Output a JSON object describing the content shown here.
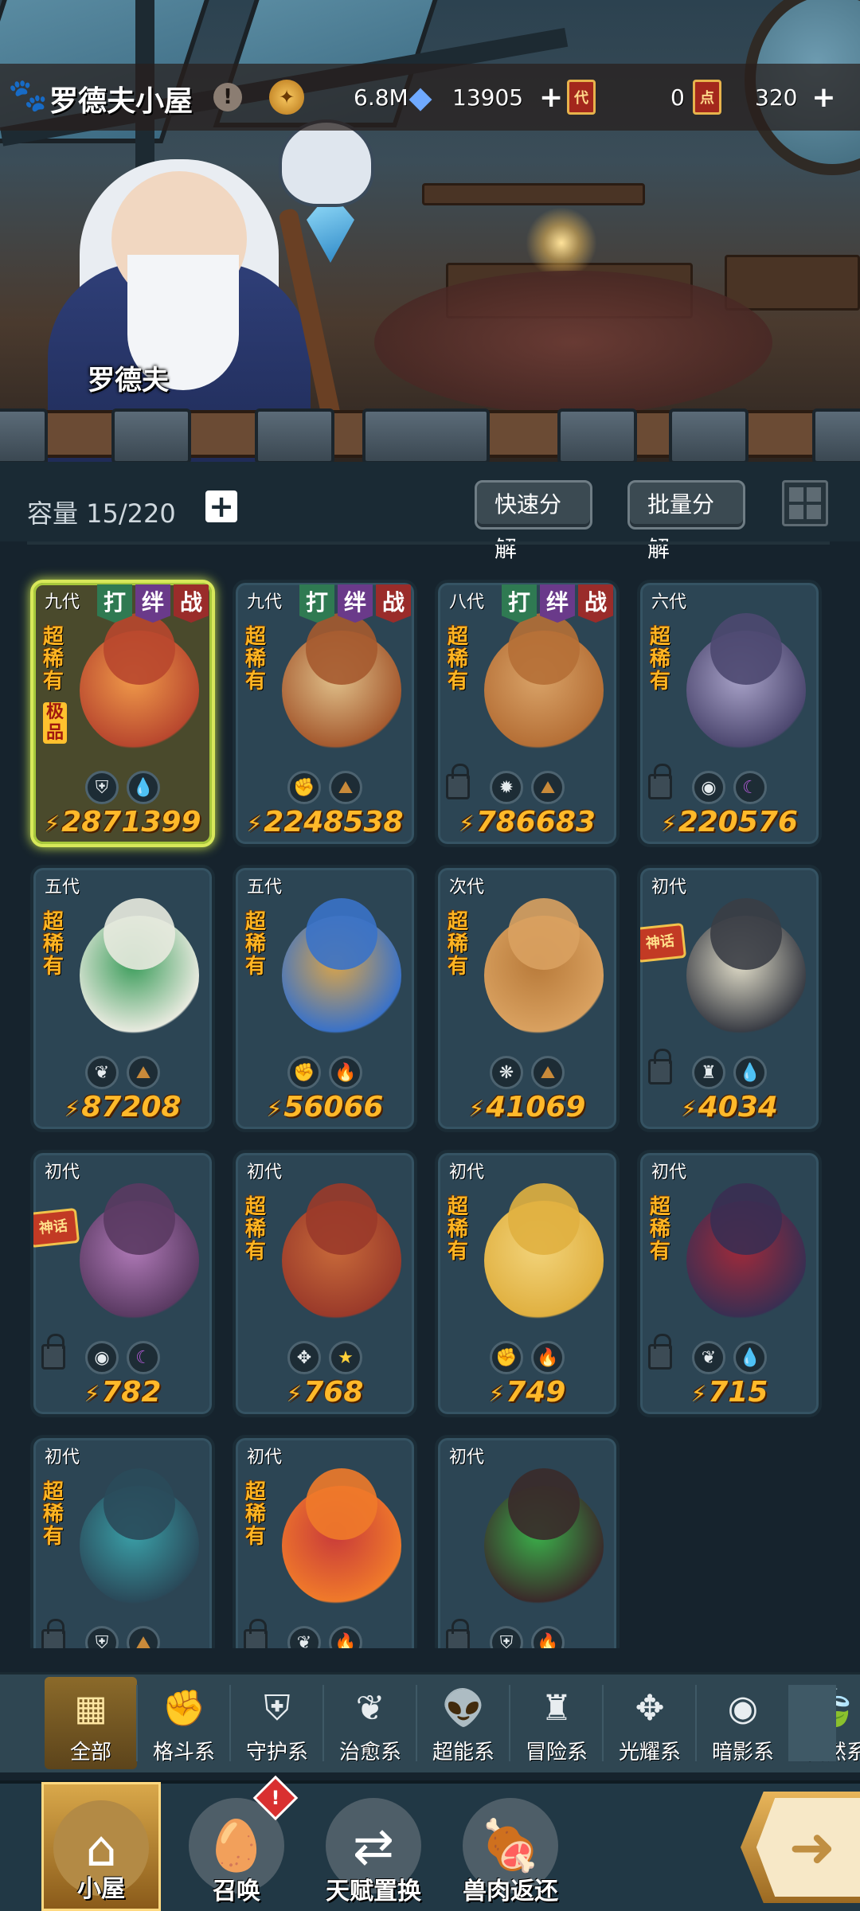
{
  "header": {
    "title": "罗德夫小屋",
    "info_icon": "exclamation-icon",
    "npc_name": "罗德夫"
  },
  "resources": [
    {
      "icon": "gold-coin-icon",
      "value": "6.8M",
      "has_plus": false
    },
    {
      "icon": "crystal-gem-icon",
      "value": "13905",
      "has_plus": true
    },
    {
      "icon": "ticket-red-icon",
      "glyph": "代",
      "value": "0",
      "has_plus": false
    },
    {
      "icon": "ticket-red-icon",
      "glyph": "点",
      "value": "320",
      "has_plus": true
    }
  ],
  "toolbar": {
    "capacity_label": "容量 15/220",
    "quick_decompose": "快速分解",
    "batch_decompose": "批量分解",
    "grid_view_icon": "grid-view-icon"
  },
  "colors": {
    "accent_gold": "#ffb92a",
    "selected_border": "#d8e85a",
    "card_bg": "#2c4554",
    "tag_fight": "#2f7a52",
    "tag_bond": "#6a3a8a",
    "tag_war": "#9a2c2a"
  },
  "pets": [
    {
      "gen": "九代",
      "tags": [
        "打",
        "绊",
        "战"
      ],
      "rarity": "超稀有",
      "quality": "极品",
      "locked": false,
      "selected": true,
      "badge": "",
      "elements": [
        "guardian-icon",
        "water-drop-icon"
      ],
      "power": "2871399",
      "sprite": [
        "#b8472e",
        "#f09a4a"
      ]
    },
    {
      "gen": "九代",
      "tags": [
        "打",
        "绊",
        "战"
      ],
      "rarity": "超稀有",
      "quality": "",
      "locked": false,
      "selected": false,
      "badge": "",
      "elements": [
        "fist-icon",
        "earth-icon"
      ],
      "power": "2248538",
      "sprite": [
        "#a55a2f",
        "#e0c08a"
      ]
    },
    {
      "gen": "八代",
      "tags": [
        "打",
        "绊",
        "战"
      ],
      "rarity": "超稀有",
      "quality": "",
      "locked": true,
      "selected": false,
      "badge": "",
      "elements": [
        "light-icon",
        "earth-icon"
      ],
      "power": "786683",
      "sprite": [
        "#b56f36",
        "#d9a368"
      ]
    },
    {
      "gen": "六代",
      "tags": [],
      "rarity": "超稀有",
      "quality": "",
      "locked": true,
      "selected": false,
      "badge": "",
      "elements": [
        "shadow-icon",
        "moon-icon"
      ],
      "power": "220576",
      "sprite": [
        "#4d4870",
        "#a8a2c8"
      ]
    },
    {
      "gen": "五代",
      "tags": [],
      "rarity": "超稀有",
      "quality": "",
      "locked": false,
      "selected": false,
      "badge": "",
      "elements": [
        "leaf-icon",
        "earth-icon"
      ],
      "power": "87208",
      "sprite": [
        "#e8eadf",
        "#3a9c5a"
      ]
    },
    {
      "gen": "五代",
      "tags": [],
      "rarity": "超稀有",
      "quality": "",
      "locked": false,
      "selected": false,
      "badge": "",
      "elements": [
        "fist-icon",
        "fire-icon"
      ],
      "power": "56066",
      "sprite": [
        "#3a72c8",
        "#d9a44a"
      ]
    },
    {
      "gen": "次代",
      "tags": [],
      "rarity": "超稀有",
      "quality": "",
      "locked": false,
      "selected": false,
      "badge": "",
      "elements": [
        "wind-icon",
        "earth-icon"
      ],
      "power": "41069",
      "sprite": [
        "#d9a160",
        "#b87a3a"
      ]
    },
    {
      "gen": "初代",
      "tags": [],
      "rarity": "",
      "quality": "",
      "locked": true,
      "selected": false,
      "badge": "神话",
      "elements": [
        "adventure-icon",
        "water-drop-icon"
      ],
      "power": "4034",
      "sprite": [
        "#3a3d45",
        "#e0dcc8"
      ]
    },
    {
      "gen": "初代",
      "tags": [],
      "rarity": "",
      "quality": "",
      "locked": true,
      "selected": false,
      "badge": "神话",
      "elements": [
        "shadow-icon",
        "moon-icon"
      ],
      "power": "782",
      "sprite": [
        "#5a3a62",
        "#b07ab8"
      ]
    },
    {
      "gen": "初代",
      "tags": [],
      "rarity": "超稀有",
      "quality": "",
      "locked": false,
      "selected": false,
      "badge": "",
      "elements": [
        "radiance-icon",
        "star-icon"
      ],
      "power": "768",
      "sprite": [
        "#9a3a2a",
        "#c86a3a"
      ]
    },
    {
      "gen": "初代",
      "tags": [],
      "rarity": "超稀有",
      "quality": "",
      "locked": false,
      "selected": false,
      "badge": "",
      "elements": [
        "fist-icon",
        "fire-icon"
      ],
      "power": "749",
      "sprite": [
        "#e0b040",
        "#f2d37a"
      ]
    },
    {
      "gen": "初代",
      "tags": [],
      "rarity": "超稀有",
      "quality": "",
      "locked": true,
      "selected": false,
      "badge": "",
      "elements": [
        "leaf-icon",
        "water-drop-icon"
      ],
      "power": "715",
      "sprite": [
        "#3a2e52",
        "#a02a3a"
      ]
    },
    {
      "gen": "初代",
      "tags": [],
      "rarity": "超稀有",
      "quality": "",
      "locked": true,
      "selected": false,
      "badge": "",
      "elements": [
        "guardian-icon",
        "earth-icon"
      ],
      "power": "",
      "sprite": [
        "#2a4a5a",
        "#3aa0a8"
      ]
    },
    {
      "gen": "初代",
      "tags": [],
      "rarity": "超稀有",
      "quality": "",
      "locked": true,
      "selected": false,
      "badge": "",
      "elements": [
        "leaf-icon",
        "fire-icon"
      ],
      "power": "",
      "sprite": [
        "#f07a2a",
        "#c83a3a"
      ]
    },
    {
      "gen": "初代",
      "tags": [],
      "rarity": "",
      "quality": "",
      "locked": true,
      "selected": false,
      "badge": "",
      "elements": [
        "guardian-icon",
        "fire-icon"
      ],
      "power": "",
      "sprite": [
        "#3a2a2a",
        "#3ab04a"
      ]
    }
  ],
  "categories": [
    {
      "label": "全部",
      "icon": "all-blocks-icon",
      "active": true
    },
    {
      "label": "格斗系",
      "icon": "fist-icon",
      "active": false
    },
    {
      "label": "守护系",
      "icon": "guardian-icon",
      "active": false
    },
    {
      "label": "治愈系",
      "icon": "leaf-icon",
      "active": false
    },
    {
      "label": "超能系",
      "icon": "alien-icon",
      "active": false
    },
    {
      "label": "冒险系",
      "icon": "adventure-icon",
      "active": false
    },
    {
      "label": "光耀系",
      "icon": "radiance-icon",
      "active": false
    },
    {
      "label": "暗影系",
      "icon": "shadow-icon",
      "active": false
    },
    {
      "label": "自然系",
      "icon": "nature-icon",
      "active": false
    }
  ],
  "nav": [
    {
      "label": "小屋",
      "icon": "house-icon",
      "active": true,
      "badge": ""
    },
    {
      "label": "召唤",
      "icon": "egg-icon",
      "active": false,
      "badge": "!"
    },
    {
      "label": "天赋置换",
      "icon": "swap-arrows-icon",
      "active": false,
      "badge": ""
    },
    {
      "label": "兽肉返还",
      "icon": "meat-icon",
      "active": false,
      "badge": ""
    },
    {
      "label": "",
      "icon": "arrow-forward-icon",
      "active": false,
      "badge": ""
    }
  ]
}
